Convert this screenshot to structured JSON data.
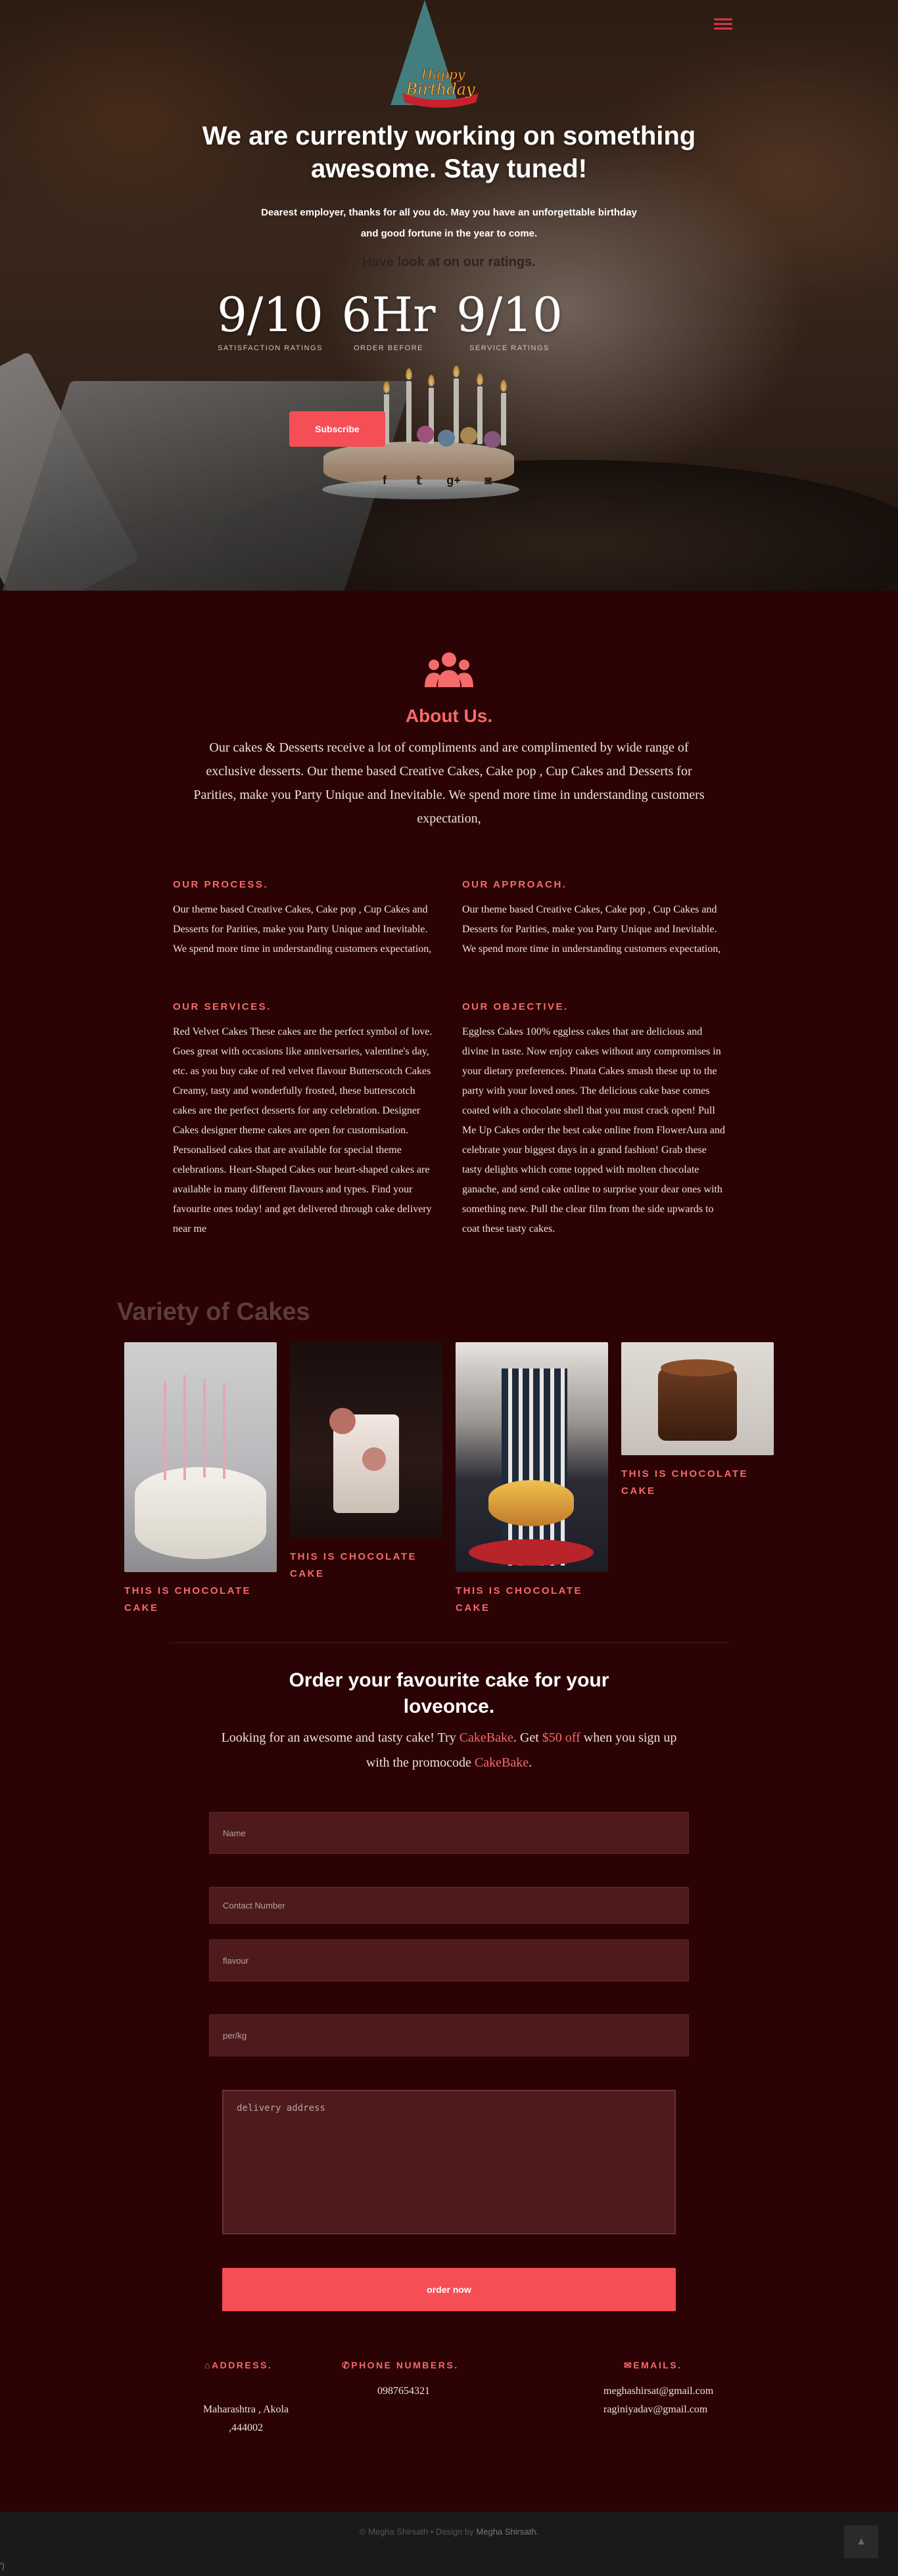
{
  "hero": {
    "logo_line1": "Happy",
    "logo_line2": "Birthday",
    "title": "We are currently working on something awesome. Stay tuned!",
    "subtitle": "Dearest employer, thanks for all you do. May you have an unforgettable birthday and good fortune in the year to come.",
    "ratings_heading": "Have look at on our ratings.",
    "stats": [
      {
        "value": "9/10",
        "label": "Satisfaction Ratings"
      },
      {
        "value": "6Hr",
        "label": "Order Before"
      },
      {
        "value": "9/10",
        "label": "Service Ratings"
      }
    ],
    "subscribe_label": "Subscribe",
    "socials": [
      {
        "icon": "facebook-icon",
        "glyph": "f"
      },
      {
        "icon": "twitter-icon",
        "glyph": "𝕥"
      },
      {
        "icon": "google-plus-icon",
        "glyph": "g+"
      },
      {
        "icon": "instagram-icon",
        "glyph": "◙"
      },
      {
        "icon": "skype-icon",
        "glyph": "ⓢ"
      }
    ]
  },
  "about": {
    "icon": "users-icon",
    "title": "About Us.",
    "text": "Our cakes & Desserts receive a lot of compliments and are complimented by wide range of exclusive desserts. Our theme based Creative Cakes, Cake pop , Cup Cakes and Desserts for Parities, make you Party Unique and Inevitable. We spend more time in understanding customers expectation,",
    "process_heading": "Our Process.",
    "process_text": "Our theme based Creative Cakes, Cake pop , Cup Cakes and Desserts for Parities, make you Party Unique and Inevitable. We spend more time in understanding customers expectation,",
    "approach_heading": "Our Approach.",
    "approach_text": "Our theme based Creative Cakes, Cake pop , Cup Cakes and Desserts for Parities, make you Party Unique and Inevitable. We spend more time in understanding customers expectation,",
    "services_heading": "Our Services.",
    "services_text": "Red Velvet Cakes These cakes are the perfect symbol of love. Goes great with occasions like anniversaries, valentine's day, etc. as you buy cake of red velvet flavour Butterscotch Cakes Creamy, tasty and wonderfully frosted, these butterscotch cakes are the perfect desserts for any celebration. Designer Cakes designer theme cakes are open for customisation. Personalised cakes that are available for special theme celebrations. Heart-Shaped Cakes our heart-shaped cakes are available in many different flavours and types. Find your favourite ones today! and get delivered through cake delivery near me",
    "objective_heading": "Our Objective.",
    "objective_text": "Eggless Cakes 100% eggless cakes that are delicious and divine in taste. Now enjoy cakes without any compromises in your dietary preferences. Pinata Cakes smash these up to the party with your loved ones. The delicious cake base comes coated with a chocolate shell that you must crack open! Pull Me Up Cakes order the best cake online from FlowerAura and celebrate your biggest days in a grand fashion! Grab these tasty delights which come topped with molten chocolate ganache, and send cake online to surprise your dear ones with something new. Pull the clear film from the side upwards to coat these tasty cakes."
  },
  "variety": {
    "title": "Variety of Cakes",
    "cards": [
      {
        "caption": "This is chocolate cake"
      },
      {
        "caption": "This is chocolate cake"
      },
      {
        "caption": "This is chocolate cake"
      },
      {
        "caption": "This is chocolate cake"
      }
    ]
  },
  "order": {
    "title": "Order your favourite cake for your loveonce.",
    "text_before": "Looking for an awesome and tasty cake! Try ",
    "brand": "CakeBake",
    "text_mid1": ". Get ",
    "discount": "$50 off",
    "text_mid2": " when you sign up with the promocode ",
    "promo": "CakeBake",
    "text_end": ".",
    "name_placeholder": "Name",
    "contact_placeholder": "Contact Number",
    "flavour_placeholder": "flavour",
    "weight_placeholder": "per/kg",
    "address_placeholder": "delivery address",
    "order_label": "order now"
  },
  "contact": {
    "address_heading": "Address.",
    "address_line1": "Maharashtra , Akola",
    "address_line2": ",444002",
    "phone_heading": "Phone Numbers.",
    "phone": "0987654321",
    "email_heading": "Emails.",
    "email1": "meghashirsat@gmail.com",
    "email2": "raginiyadav@gmail.com"
  },
  "footer": {
    "copyright": "© Megha Shirsath",
    "separator": "•",
    "design_by": "Design by",
    "designer": "Megha Shirsath.",
    "to_top_icon": "arrow-up-icon",
    "stray_text": "')"
  },
  "colors": {
    "background": "#2b0304",
    "accent": "#f56a6a",
    "button": "#f54e55",
    "field": "#4e1a1c",
    "footer": "#1a1a1a"
  }
}
